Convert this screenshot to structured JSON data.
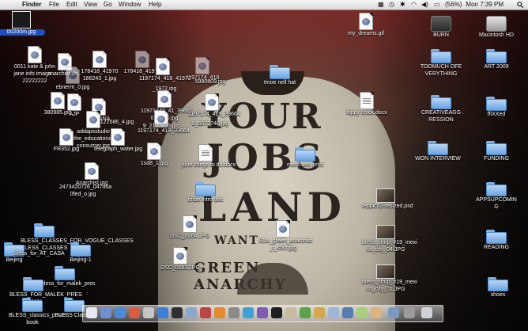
{
  "menubar": {
    "app_name": "Finder",
    "menus": [
      "File",
      "Edit",
      "View",
      "Go",
      "Window",
      "Help"
    ],
    "battery": "(56%)",
    "clock": "Mon 7:39 PM"
  },
  "colors": {
    "selection": "#1d4fc2",
    "folder": "#6aa3e0",
    "menubar": "#e8e8e8"
  },
  "desktop": {
    "left_icons": [
      {
        "label": "00200m.jpg",
        "selected": true
      },
      {
        "label": "0011 kate & john"
      },
      {
        "label": "jane info image..."
      },
      {
        "label": "22222222"
      },
      {
        "label": "anarchist sh..."
      },
      {
        "label": "178418_41970"
      },
      {
        "label": "186243_1.jpg"
      },
      {
        "label": "ebnerm_0.jpg"
      },
      {
        "label": "178418_41970"
      },
      {
        "label": "1197174_419"
      },
      {
        "label": "1197174_418_41972"
      },
      {
        "label": "5980809.jpg"
      },
      {
        "label": "_1972.jpg"
      },
      {
        "label": "AJP"
      },
      {
        "label": "AJP ANA"
      },
      {
        "label": "380985.jpg"
      },
      {
        "label": "addapsstudio"
      },
      {
        "label": "the_educational"
      },
      {
        "label": "consumer.jpg"
      },
      {
        "label": "FR352.jpg"
      },
      {
        "label": "telegraph_water.jpg"
      },
      {
        "label": "11971742_41_39665"
      },
      {
        "label": "0_3828.jpg"
      },
      {
        "label": "1197174_419_39664"
      },
      {
        "label": "1197174_419_39664"
      },
      {
        "label": "9_2100795.jpg"
      },
      {
        "label": "8_5570740.jpg"
      },
      {
        "label": "122586_4.jpg"
      },
      {
        "label": "Anarchist.jpg"
      },
      {
        "label": "1sd8_1.jpg"
      },
      {
        "label": "2473420726_047d6a"
      },
      {
        "label": "0fed_o.jpg"
      },
      {
        "label": "june things to do.docx"
      },
      {
        "label": "tmoe intro text"
      },
      {
        "label": "tmoe nell hat"
      },
      {
        "label": "hippy chick.docx"
      },
      {
        "label": "mesh test print"
      },
      {
        "label": "my_dreams.gif"
      },
      {
        "label": "DSC_0064.JPG"
      },
      {
        "label": "DSC_0063.JPG"
      },
      {
        "label": "81w_green_anarchist"
      },
      {
        "label": "_t_shirt.jpg"
      },
      {
        "label": "BLESS_CLASSES_FOR_VOGUE_CLASSES"
      },
      {
        "label": "BLESS_CLASSES"
      },
      {
        "label": "Beijing"
      },
      {
        "label": "Beijing-1"
      },
      {
        "label": "bless_for_AT_CASA"
      },
      {
        "label": "bless_for_malek_pres"
      },
      {
        "label": "BLESS_FOR_MALEK_PRES"
      },
      {
        "label": "DMAN"
      },
      {
        "label": "BLESS_classics_poster"
      },
      {
        "label": "book"
      },
      {
        "label": "BLESS Classes"
      },
      {
        "label": "teppich2-resized.psd"
      },
      {
        "label": "bless_shop_#19_mexi"
      },
      {
        "label": "co_city_04.JPG"
      },
      {
        "label": "bless_shop_#19_mexi"
      },
      {
        "label": "co_city_01.JPG"
      }
    ],
    "right_icons": [
      {
        "label": "BURN"
      },
      {
        "label": "Macintosh HD"
      },
      {
        "label": "TOOMUCH OFE"
      },
      {
        "label": "VERYTHING"
      },
      {
        "label": "ART 2009"
      },
      {
        "label": "CREATIVEAGG"
      },
      {
        "label": "RESSION"
      },
      {
        "label": "ffiXXed"
      },
      {
        "label": "WON INTERVIEW"
      },
      {
        "label": "FUNDING"
      },
      {
        "label": "APPSUPCOMIN"
      },
      {
        "label": "G"
      },
      {
        "label": "READING"
      },
      {
        "label": "shoes"
      }
    ]
  },
  "wallpaper": {
    "print_lines": [
      "YOUR",
      "JOBS",
      "LAND",
      "WANT",
      "GREEN ANARCHY"
    ]
  }
}
